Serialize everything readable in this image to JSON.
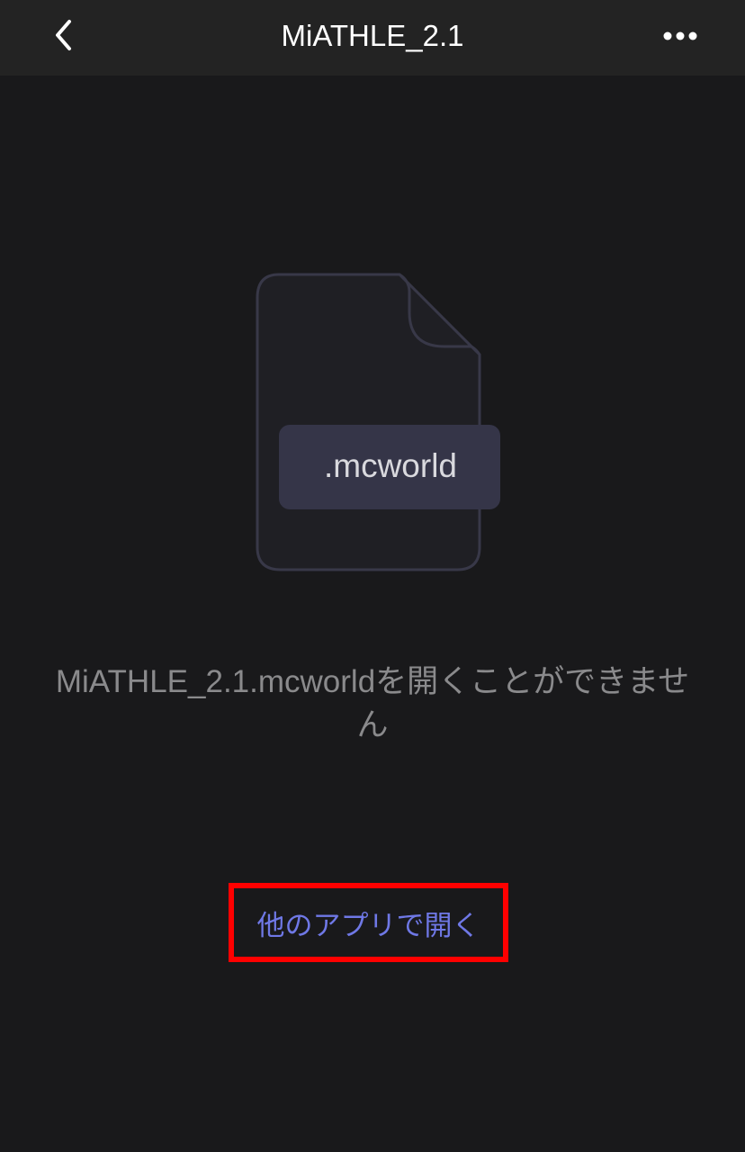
{
  "nav": {
    "title": "MiATHLE_2.1",
    "back_icon": "chevron-left-icon",
    "more_icon": "ellipsis-icon"
  },
  "file": {
    "icon": "document-icon",
    "extension": ".mcworld"
  },
  "message": "MiATHLE_2.1.mcworldを開くことができません",
  "open_with_label": "他のアプリで開く",
  "colors": {
    "background": "#19191b",
    "nav_background": "#232323",
    "link": "#6f78e6",
    "highlight_border": "#ff0000"
  }
}
